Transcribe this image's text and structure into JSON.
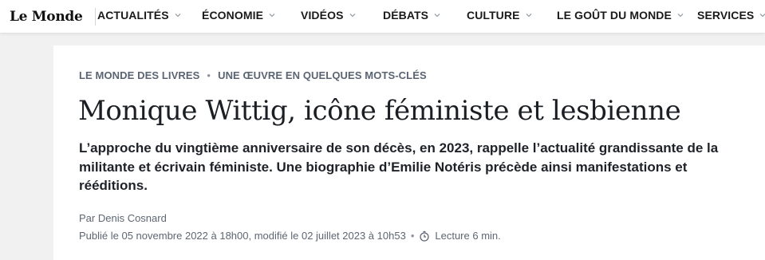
{
  "header": {
    "logo": "Le Monde",
    "nav": [
      {
        "label": "ACTUALITÉS"
      },
      {
        "label": "ÉCONOMIE"
      },
      {
        "label": "VIDÉOS"
      },
      {
        "label": "DÉBATS"
      },
      {
        "label": "CULTURE"
      },
      {
        "label": "LE GOÛT DU MONDE"
      },
      {
        "label": "SERVICES"
      }
    ]
  },
  "article": {
    "breadcrumb": [
      "LE MONDE DES LIVRES",
      "UNE ŒUVRE EN QUELQUES MOTS-CLÉS"
    ],
    "breadcrumb_separator": "•",
    "title": "Monique Wittig, icône féministe et lesbienne",
    "lead": "L’approche du vingtième anniversaire de son décès, en 2023, rappelle l’actualité grandissante de la militante et écrivain féministe. Une biographie d’Emilie Notéris précède ainsi manifestations et rééditions.",
    "byline": "Par Denis Cosnard",
    "published": "Publié le 05 novembre 2022 à 18h00, modifié le 02 juillet 2023 à 10h53",
    "meta_separator": "•",
    "reading_time": "Lecture 6 min."
  },
  "icons": {
    "nav_chevron": "chevron-down-icon",
    "reading_time": "clock-icon"
  },
  "colors": {
    "kicker": "#5a6472",
    "text": "#1b1f24",
    "background": "#f1f1f1"
  }
}
